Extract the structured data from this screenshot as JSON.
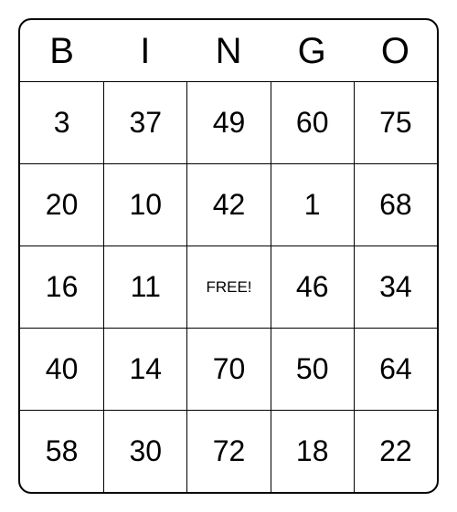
{
  "header": [
    "B",
    "I",
    "N",
    "G",
    "O"
  ],
  "grid": [
    [
      "3",
      "37",
      "49",
      "60",
      "75"
    ],
    [
      "20",
      "10",
      "42",
      "1",
      "68"
    ],
    [
      "16",
      "11",
      "FREE!",
      "46",
      "34"
    ],
    [
      "40",
      "14",
      "70",
      "50",
      "64"
    ],
    [
      "58",
      "30",
      "72",
      "18",
      "22"
    ]
  ],
  "free_cell": {
    "row": 2,
    "col": 2
  }
}
